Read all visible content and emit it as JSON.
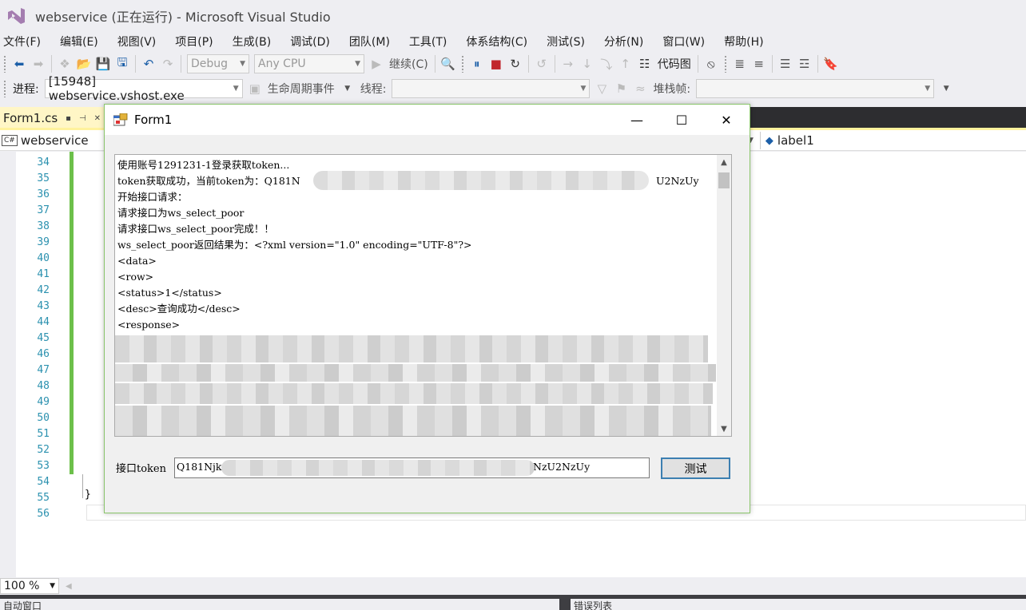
{
  "window": {
    "title": "webservice (正在运行) - Microsoft Visual Studio"
  },
  "menu": {
    "items": [
      "文件(F)",
      "编辑(E)",
      "视图(V)",
      "项目(P)",
      "生成(B)",
      "调试(D)",
      "团队(M)",
      "工具(T)",
      "体系结构(C)",
      "测试(S)",
      "分析(N)",
      "窗口(W)",
      "帮助(H)"
    ]
  },
  "toolbar": {
    "config": "Debug",
    "platform": "Any CPU",
    "continue_label": "继续(C)",
    "codemap_label": "代码图"
  },
  "debug_toolbar": {
    "process_label": "进程:",
    "process_value": "[15948] webservice.vshost.exe",
    "lifecycle_label": "生命周期事件",
    "thread_label": "线程:",
    "stackframe_label": "堆栈帧:"
  },
  "tabs": {
    "active": "Form1.cs"
  },
  "navbar": {
    "project": "webservice",
    "member": "label1"
  },
  "editor": {
    "line_numbers": [
      "34",
      "35",
      "36",
      "37",
      "38",
      "39",
      "40",
      "41",
      "42",
      "43",
      "44",
      "45",
      "46",
      "47",
      "48",
      "49",
      "50",
      "51",
      "52",
      "53",
      "54",
      "55",
      "56"
    ],
    "closing_brace": "}",
    "zoom": "100 %"
  },
  "bottom": {
    "left_panel": "自动窗口",
    "right_panel": "错误列表"
  },
  "form": {
    "title": "Form1",
    "log_lines": [
      "使用账号1291231-1登录获取token...",
      "token获取成功，当前token为：Q181N",
      "开始接口请求：",
      "请求接口为ws_select_poor",
      "请求接口ws_select_poor完成！！",
      "ws_select_poor返回结果为：<?xml version=\"1.0\" encoding=\"UTF-8\"?>",
      "<data>",
      "<row>",
      "<status>1</status>",
      "<desc>查询成功</desc>",
      "<response>"
    ],
    "token_tail_line2": "U2NzUy",
    "token_label": "接口token",
    "token_value_start": "Q181Njk",
    "token_value_end": "NzU2NzUy",
    "test_button": "测试"
  },
  "colors": {
    "accent_tab": "#fff6c6",
    "change_bar": "#6cc04a",
    "line_number": "#2b91af",
    "form_border": "#8ac56a",
    "button_focus": "#3c7fb1"
  }
}
